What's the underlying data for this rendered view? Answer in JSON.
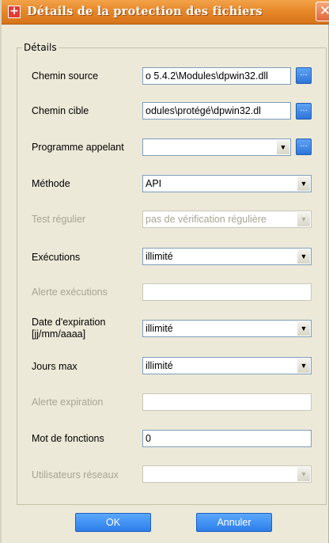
{
  "window": {
    "title": "Détails de la protection des fichiers",
    "app_icon": "+",
    "close_glyph": "✕"
  },
  "group": {
    "legend": "Détails"
  },
  "fields": {
    "source": {
      "label": "Chemin source",
      "value": "o 5.4.2\\Modules\\dpwin32.dll",
      "browse": "..."
    },
    "target": {
      "label": "Chemin cible",
      "value": "odules\\protégé\\dpwin32.dl",
      "browse": "..."
    },
    "caller": {
      "label": "Programme appelant",
      "value": "",
      "browse": "..."
    },
    "method": {
      "label": "Méthode",
      "value": "API"
    },
    "regular_test": {
      "label": "Test régulier",
      "value": "pas de vérification régulière"
    },
    "executions": {
      "label": "Exécutions",
      "value": "illimité"
    },
    "exec_alert": {
      "label": "Alerte exécutions",
      "value": ""
    },
    "expiry_date": {
      "label_line1": "Date d'expiration",
      "label_line2": "[jj/mm/aaaa]",
      "value": "illimité"
    },
    "max_days": {
      "label": "Jours max",
      "value": "illimité"
    },
    "expiry_alert": {
      "label": "Alerte expiration",
      "value": ""
    },
    "function_word": {
      "label": "Mot de fonctions",
      "value": "0"
    },
    "network_users": {
      "label": "Utilisateurs réseaux",
      "value": ""
    }
  },
  "dropdown_glyph": "▼",
  "buttons": {
    "ok": "OK",
    "cancel": "Annuler"
  },
  "colors": {
    "titlebar": "#e7892a",
    "dialog_bg": "#ece9d8",
    "button_blue": "#2d7de8",
    "disabled_text": "#a7a592"
  }
}
